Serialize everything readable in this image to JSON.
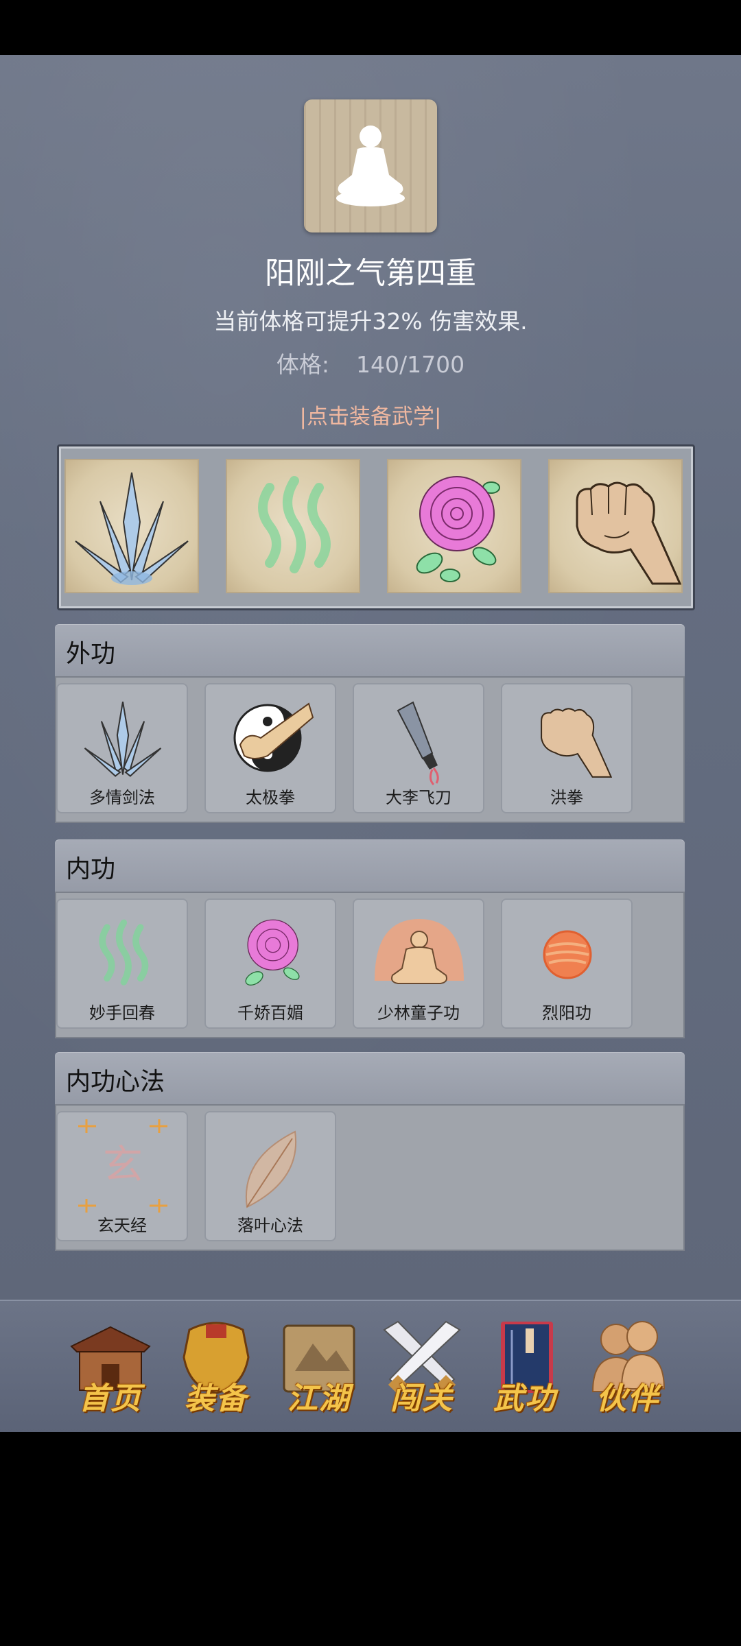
{
  "stage": {
    "title": "阳刚之气第四重",
    "description": "当前体格可提升32% 伤害效果.",
    "stat_label": "体格:",
    "stat_value": "140/1700"
  },
  "equip_hint": "|点击装备武学|",
  "equipped_slots": [
    {
      "icon": "blade-fan-icon"
    },
    {
      "icon": "green-wave-icon"
    },
    {
      "icon": "rose-icon"
    },
    {
      "icon": "fist-icon"
    }
  ],
  "sections": {
    "waigong": {
      "title": "外功",
      "items": [
        {
          "label": "多情剑法",
          "icon": "blade-fan-icon"
        },
        {
          "label": "太极拳",
          "icon": "taiji-icon"
        },
        {
          "label": "大李飞刀",
          "icon": "flying-knife-icon"
        },
        {
          "label": "洪拳",
          "icon": "fist-icon"
        }
      ]
    },
    "neigong": {
      "title": "内功",
      "items": [
        {
          "label": "妙手回春",
          "icon": "green-wave-icon"
        },
        {
          "label": "千娇百媚",
          "icon": "rose-icon"
        },
        {
          "label": "少林童子功",
          "icon": "meditating-monk-icon"
        },
        {
          "label": "烈阳功",
          "icon": "sun-orb-icon"
        }
      ]
    },
    "xinfa": {
      "title": "内功心法",
      "items": [
        {
          "label": "玄天经",
          "icon": "xuan-scroll-icon",
          "glyph": "玄"
        },
        {
          "label": "落叶心法",
          "icon": "leaf-icon"
        }
      ]
    }
  },
  "nav": [
    {
      "label": "首页",
      "icon": "house-icon"
    },
    {
      "label": "装备",
      "icon": "armor-icon"
    },
    {
      "label": "江湖",
      "icon": "scroll-map-icon"
    },
    {
      "label": "闯关",
      "icon": "crossed-swords-icon"
    },
    {
      "label": "武功",
      "icon": "martial-book-icon"
    },
    {
      "label": "伙伴",
      "icon": "companions-icon"
    }
  ],
  "colors": {
    "background": "#646d80",
    "accent_hint": "#f0b8a0",
    "nav_text": "#f4c44a"
  }
}
